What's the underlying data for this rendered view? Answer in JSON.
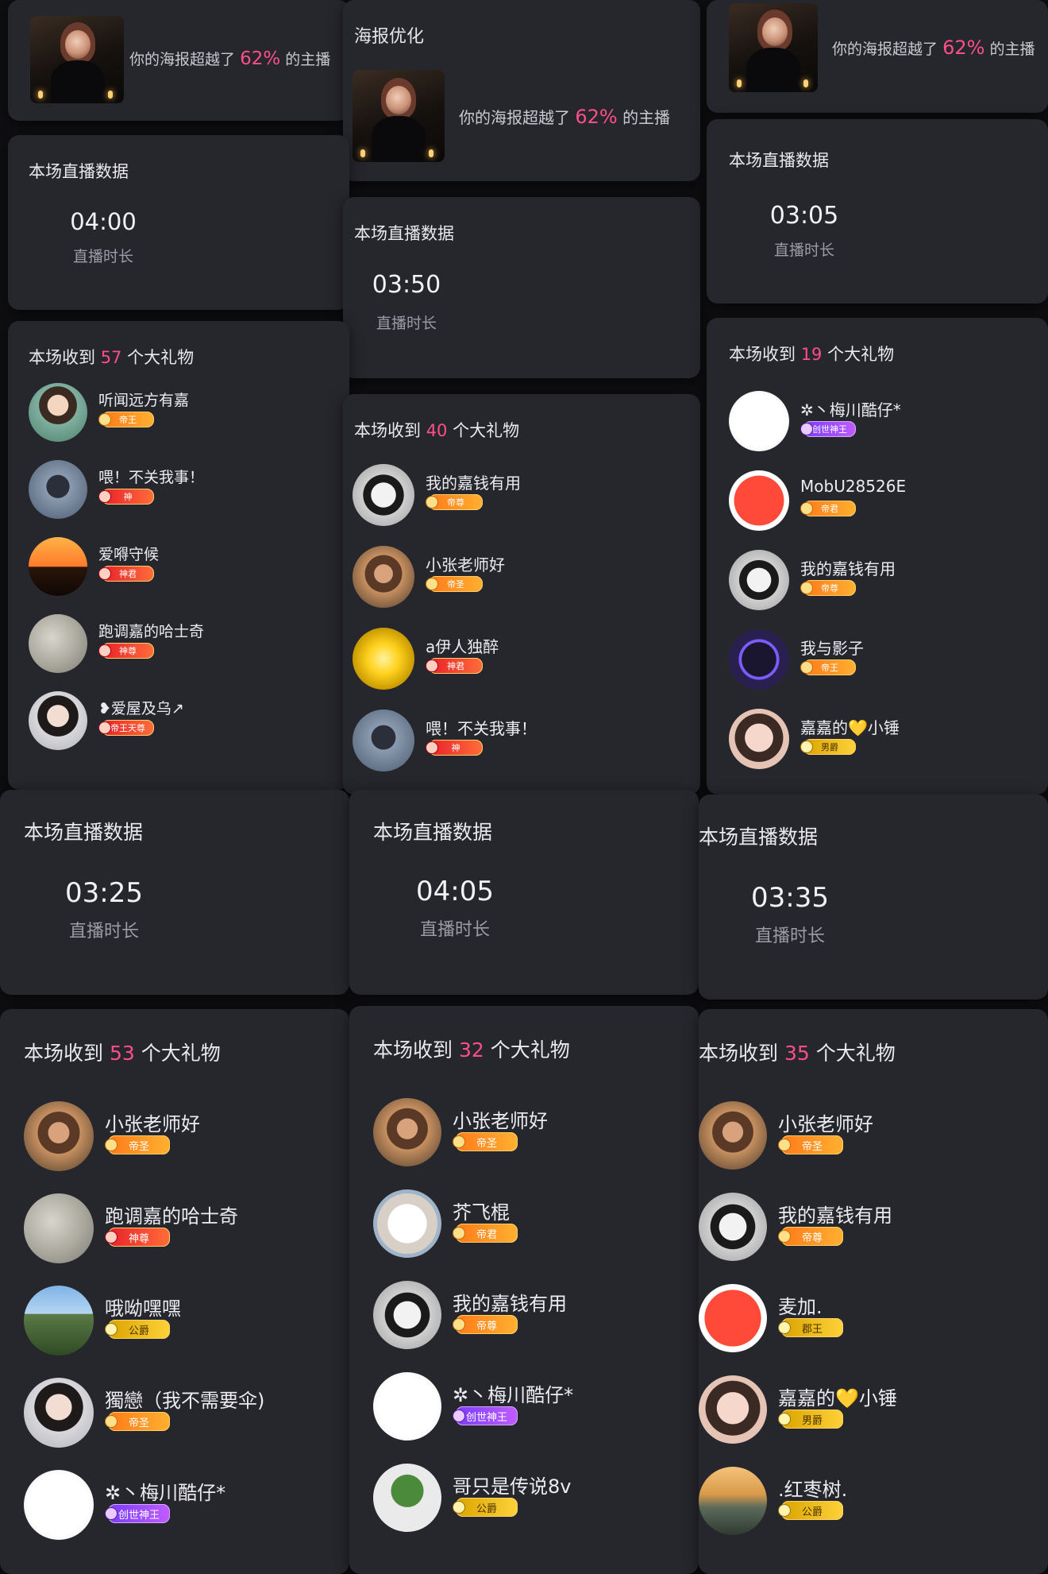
{
  "poster": {
    "title": "海报优化",
    "text_prefix": "你的海报超越了",
    "percent": "62%",
    "text_suffix": "的主播"
  },
  "labels": {
    "section_title": "本场直播数据",
    "duration_label": "直播时长",
    "gift_prefix": "本场收到",
    "gift_suffix": "个大礼物"
  },
  "panels": [
    {
      "duration": "04:00",
      "gift_count": "57",
      "users": [
        {
          "name": "听闻远方有嘉",
          "badge": "帝王",
          "avatar": "girl-illustration"
        },
        {
          "name": "喂！不关我事！",
          "badge": "神",
          "avatar": "man-back"
        },
        {
          "name": "爱嘚守候",
          "badge": "神君",
          "avatar": "sunset-silhouettes"
        },
        {
          "name": "跑调嘉的哈士奇",
          "badge": "神尊",
          "avatar": "moon"
        },
        {
          "name": "❥爱屋及乌↗",
          "badge": "帝王天尊",
          "avatar": "woman-portrait"
        }
      ]
    },
    {
      "duration": "03:50",
      "gift_count": "40",
      "users": [
        {
          "name": "我的嘉钱有用",
          "badge": "帝尊",
          "avatar": "anime-boy"
        },
        {
          "name": "小张老师好",
          "badge": "帝圣",
          "avatar": "woman-sunset"
        },
        {
          "name": "a伊人独醉",
          "badge": "神君",
          "avatar": "yellow-flower"
        },
        {
          "name": "喂！不关我事！",
          "badge": "神",
          "avatar": "man-back"
        }
      ]
    },
    {
      "duration": "03:05",
      "gift_count": "19",
      "users": [
        {
          "name": "✲丶梅川酷仔*",
          "badge": "创世神王",
          "avatar": "kuzai-logo"
        },
        {
          "name": "MobU28526E",
          "badge": "帝君",
          "avatar": "red-face"
        },
        {
          "name": "我的嘉钱有用",
          "badge": "帝尊",
          "avatar": "anime-boy"
        },
        {
          "name": "我与影子",
          "badge": "帝王",
          "avatar": "shadow-figure"
        },
        {
          "name": "嘉嘉的💛小锤",
          "badge": "男爵",
          "avatar": "woman-face"
        }
      ]
    },
    {
      "duration": "03:25",
      "gift_count": "53",
      "users": [
        {
          "name": "小张老师好",
          "badge": "帝圣",
          "avatar": "woman-sunset"
        },
        {
          "name": "跑调嘉的哈士奇",
          "badge": "神尊",
          "avatar": "moon"
        },
        {
          "name": "哦呦嘿嘿",
          "badge": "公爵",
          "avatar": "mountain"
        },
        {
          "name": "獨戀（我不需要伞)",
          "badge": "帝圣",
          "avatar": "woman-portrait"
        },
        {
          "name": "✲丶梅川酷仔*",
          "badge": "创世神王",
          "avatar": "kuzai-logo"
        }
      ]
    },
    {
      "duration": "04:05",
      "gift_count": "32",
      "users": [
        {
          "name": "小张老师好",
          "badge": "帝圣",
          "avatar": "woman-sunset"
        },
        {
          "name": "芥飞棍",
          "badge": "帝君",
          "avatar": "white-cat"
        },
        {
          "name": "我的嘉钱有用",
          "badge": "帝尊",
          "avatar": "anime-boy"
        },
        {
          "name": "✲丶梅川酷仔*",
          "badge": "创世神王",
          "avatar": "kuzai-logo"
        },
        {
          "name": "哥只是传说8v",
          "badge": "公爵",
          "avatar": "plant-pot"
        }
      ]
    },
    {
      "duration": "03:35",
      "gift_count": "35",
      "users": [
        {
          "name": "小张老师好",
          "badge": "帝圣",
          "avatar": "woman-sunset"
        },
        {
          "name": "我的嘉钱有用",
          "badge": "帝尊",
          "avatar": "anime-boy"
        },
        {
          "name": "麦加.",
          "badge": "郡王",
          "avatar": "red-face"
        },
        {
          "name": "嘉嘉的💛小锤",
          "badge": "男爵",
          "avatar": "woman-face"
        },
        {
          "name": ".红枣树.",
          "badge": "公爵",
          "avatar": "landscape-painting"
        }
      ]
    }
  ],
  "colors": {
    "accent": "#ff4f86",
    "card": "#26262d",
    "background": "#0f0f12"
  }
}
